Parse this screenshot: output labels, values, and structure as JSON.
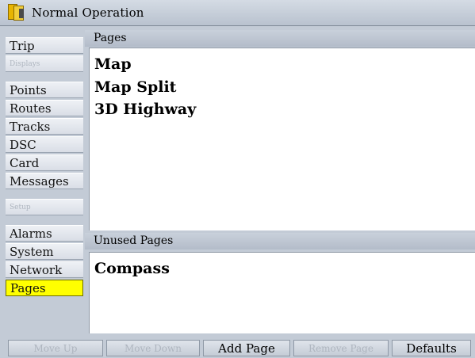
{
  "title": {
    "text": "Normal Operation",
    "icon": "book-icon"
  },
  "sidebar": {
    "items": [
      {
        "label": "Trip",
        "state": "normal"
      },
      {
        "label": "Displays",
        "state": "disabled"
      },
      {
        "label": "Points",
        "state": "normal"
      },
      {
        "label": "Routes",
        "state": "normal"
      },
      {
        "label": "Tracks",
        "state": "normal"
      },
      {
        "label": "DSC",
        "state": "normal"
      },
      {
        "label": "Card",
        "state": "normal"
      },
      {
        "label": "Messages",
        "state": "normal"
      },
      {
        "label": "Setup",
        "state": "disabled"
      },
      {
        "label": "Alarms",
        "state": "normal"
      },
      {
        "label": "System",
        "state": "normal"
      },
      {
        "label": "Network",
        "state": "normal"
      },
      {
        "label": "Pages",
        "state": "selected"
      }
    ]
  },
  "pages_section": {
    "header": "Pages",
    "items": [
      "Map",
      "Map Split",
      "3D Highway"
    ]
  },
  "unused_section": {
    "header": "Unused Pages",
    "items": [
      "Compass"
    ]
  },
  "buttons": [
    {
      "label": "Move Up",
      "state": "disabled"
    },
    {
      "label": "Move Down",
      "state": "disabled"
    },
    {
      "label": "Add Page",
      "state": "enabled"
    },
    {
      "label": "Remove Page",
      "state": "disabled"
    },
    {
      "label": "Defaults",
      "state": "enabled"
    }
  ],
  "colors": {
    "selected": "#ffff00",
    "background": "#c3cbd6",
    "panel": "#ffffff"
  }
}
